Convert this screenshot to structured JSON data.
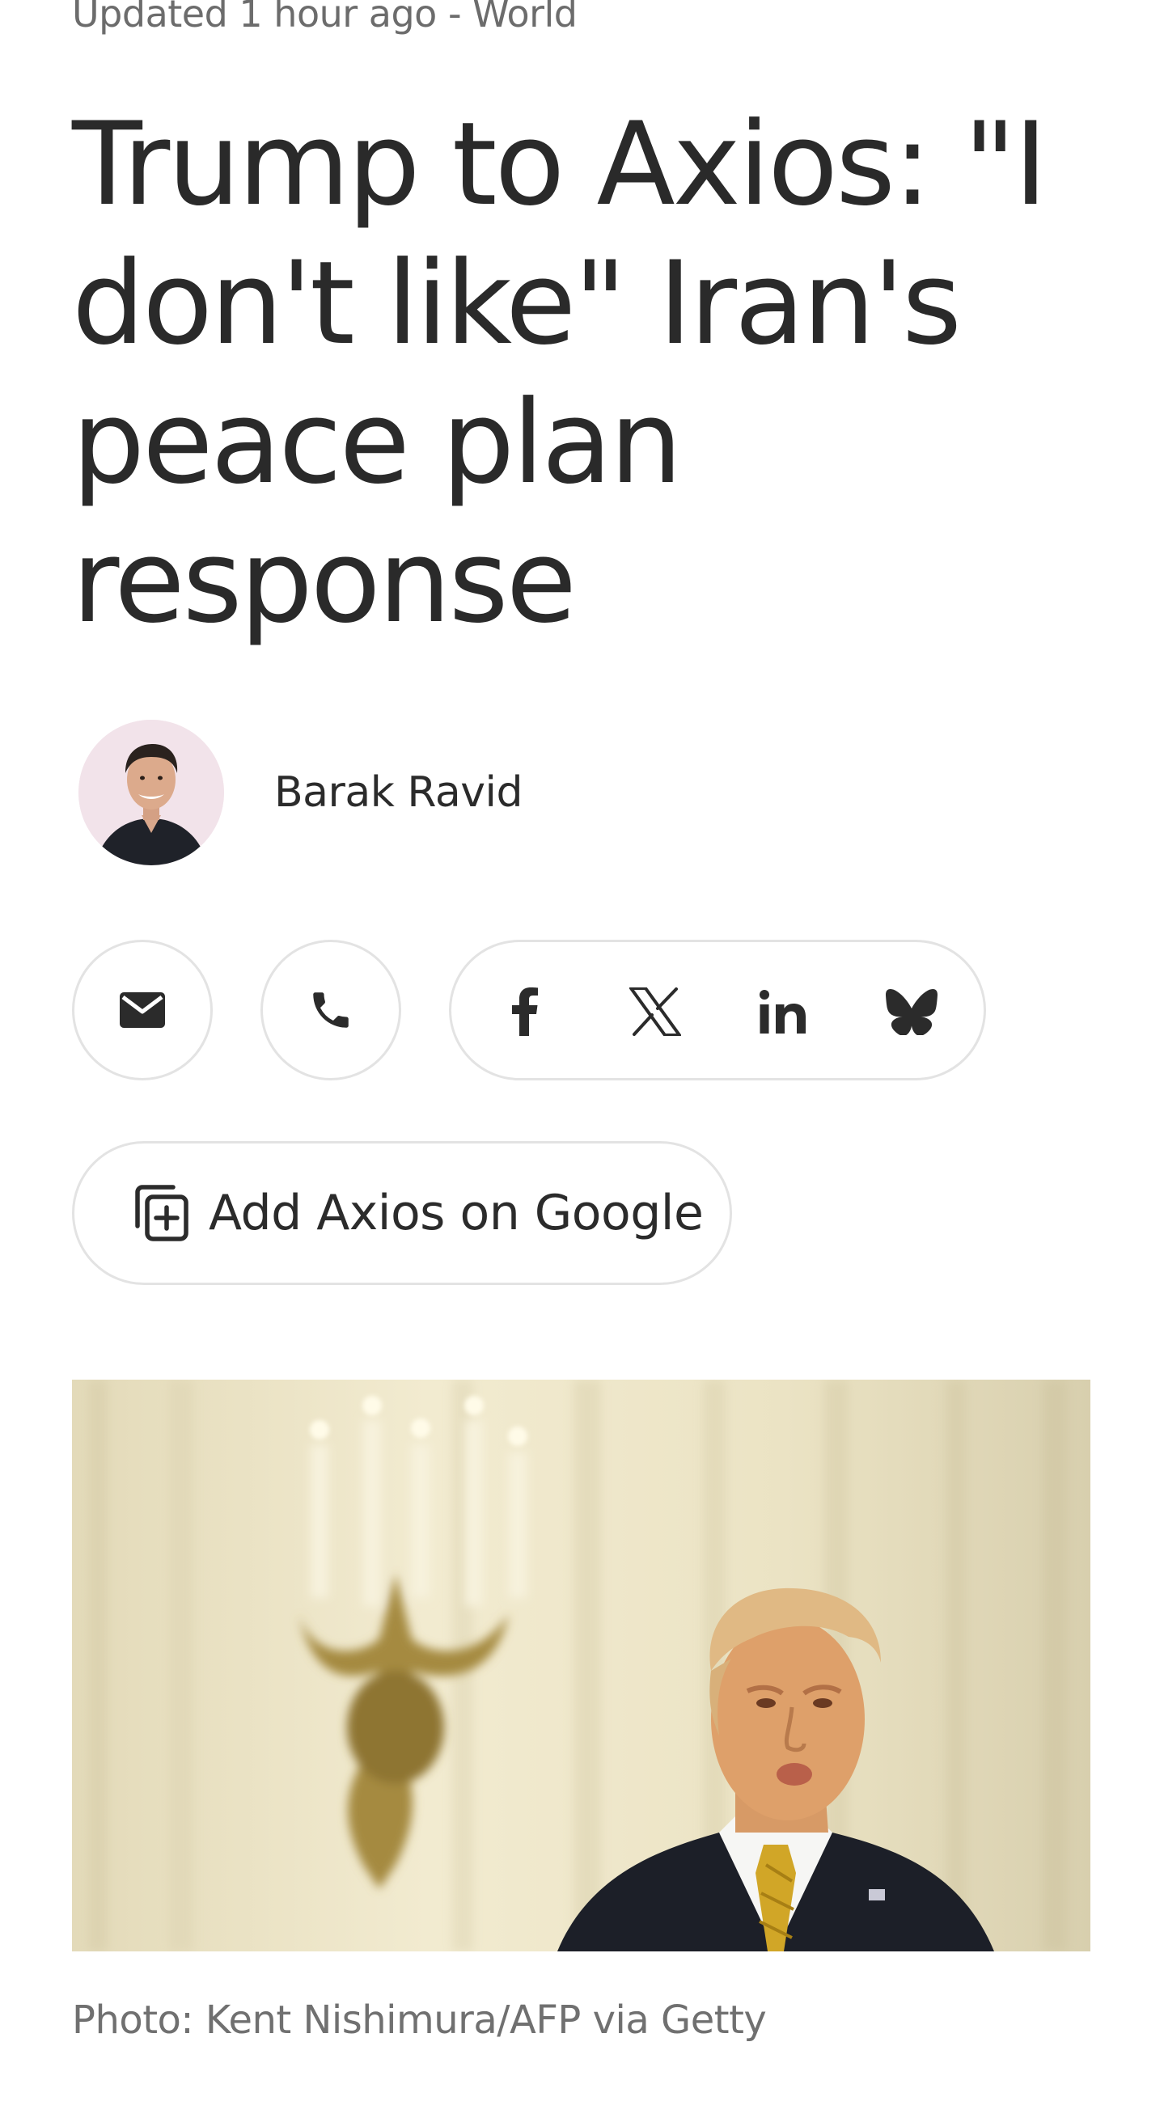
{
  "article": {
    "meta": "Updated 1 hour ago - World",
    "headline": "Trump to Axios: \"I don't like\" Iran's peace plan response",
    "author": {
      "name": "Barak Ravid",
      "avatar_icon": "author-photo"
    },
    "photo_caption": "Photo: Kent Nishimura/AFP via Getty"
  },
  "actions": {
    "contact": [
      {
        "icon": "mail-icon"
      },
      {
        "icon": "phone-icon"
      }
    ],
    "share": [
      {
        "icon": "facebook-icon"
      },
      {
        "icon": "x-icon"
      },
      {
        "icon": "linkedin-icon"
      },
      {
        "icon": "bluesky-icon"
      }
    ],
    "google_button_label": "Add Axios on Google"
  },
  "colors": {
    "text": "#2b2b2b",
    "muted": "#6c6c6c",
    "border": "#e3e3e3"
  }
}
